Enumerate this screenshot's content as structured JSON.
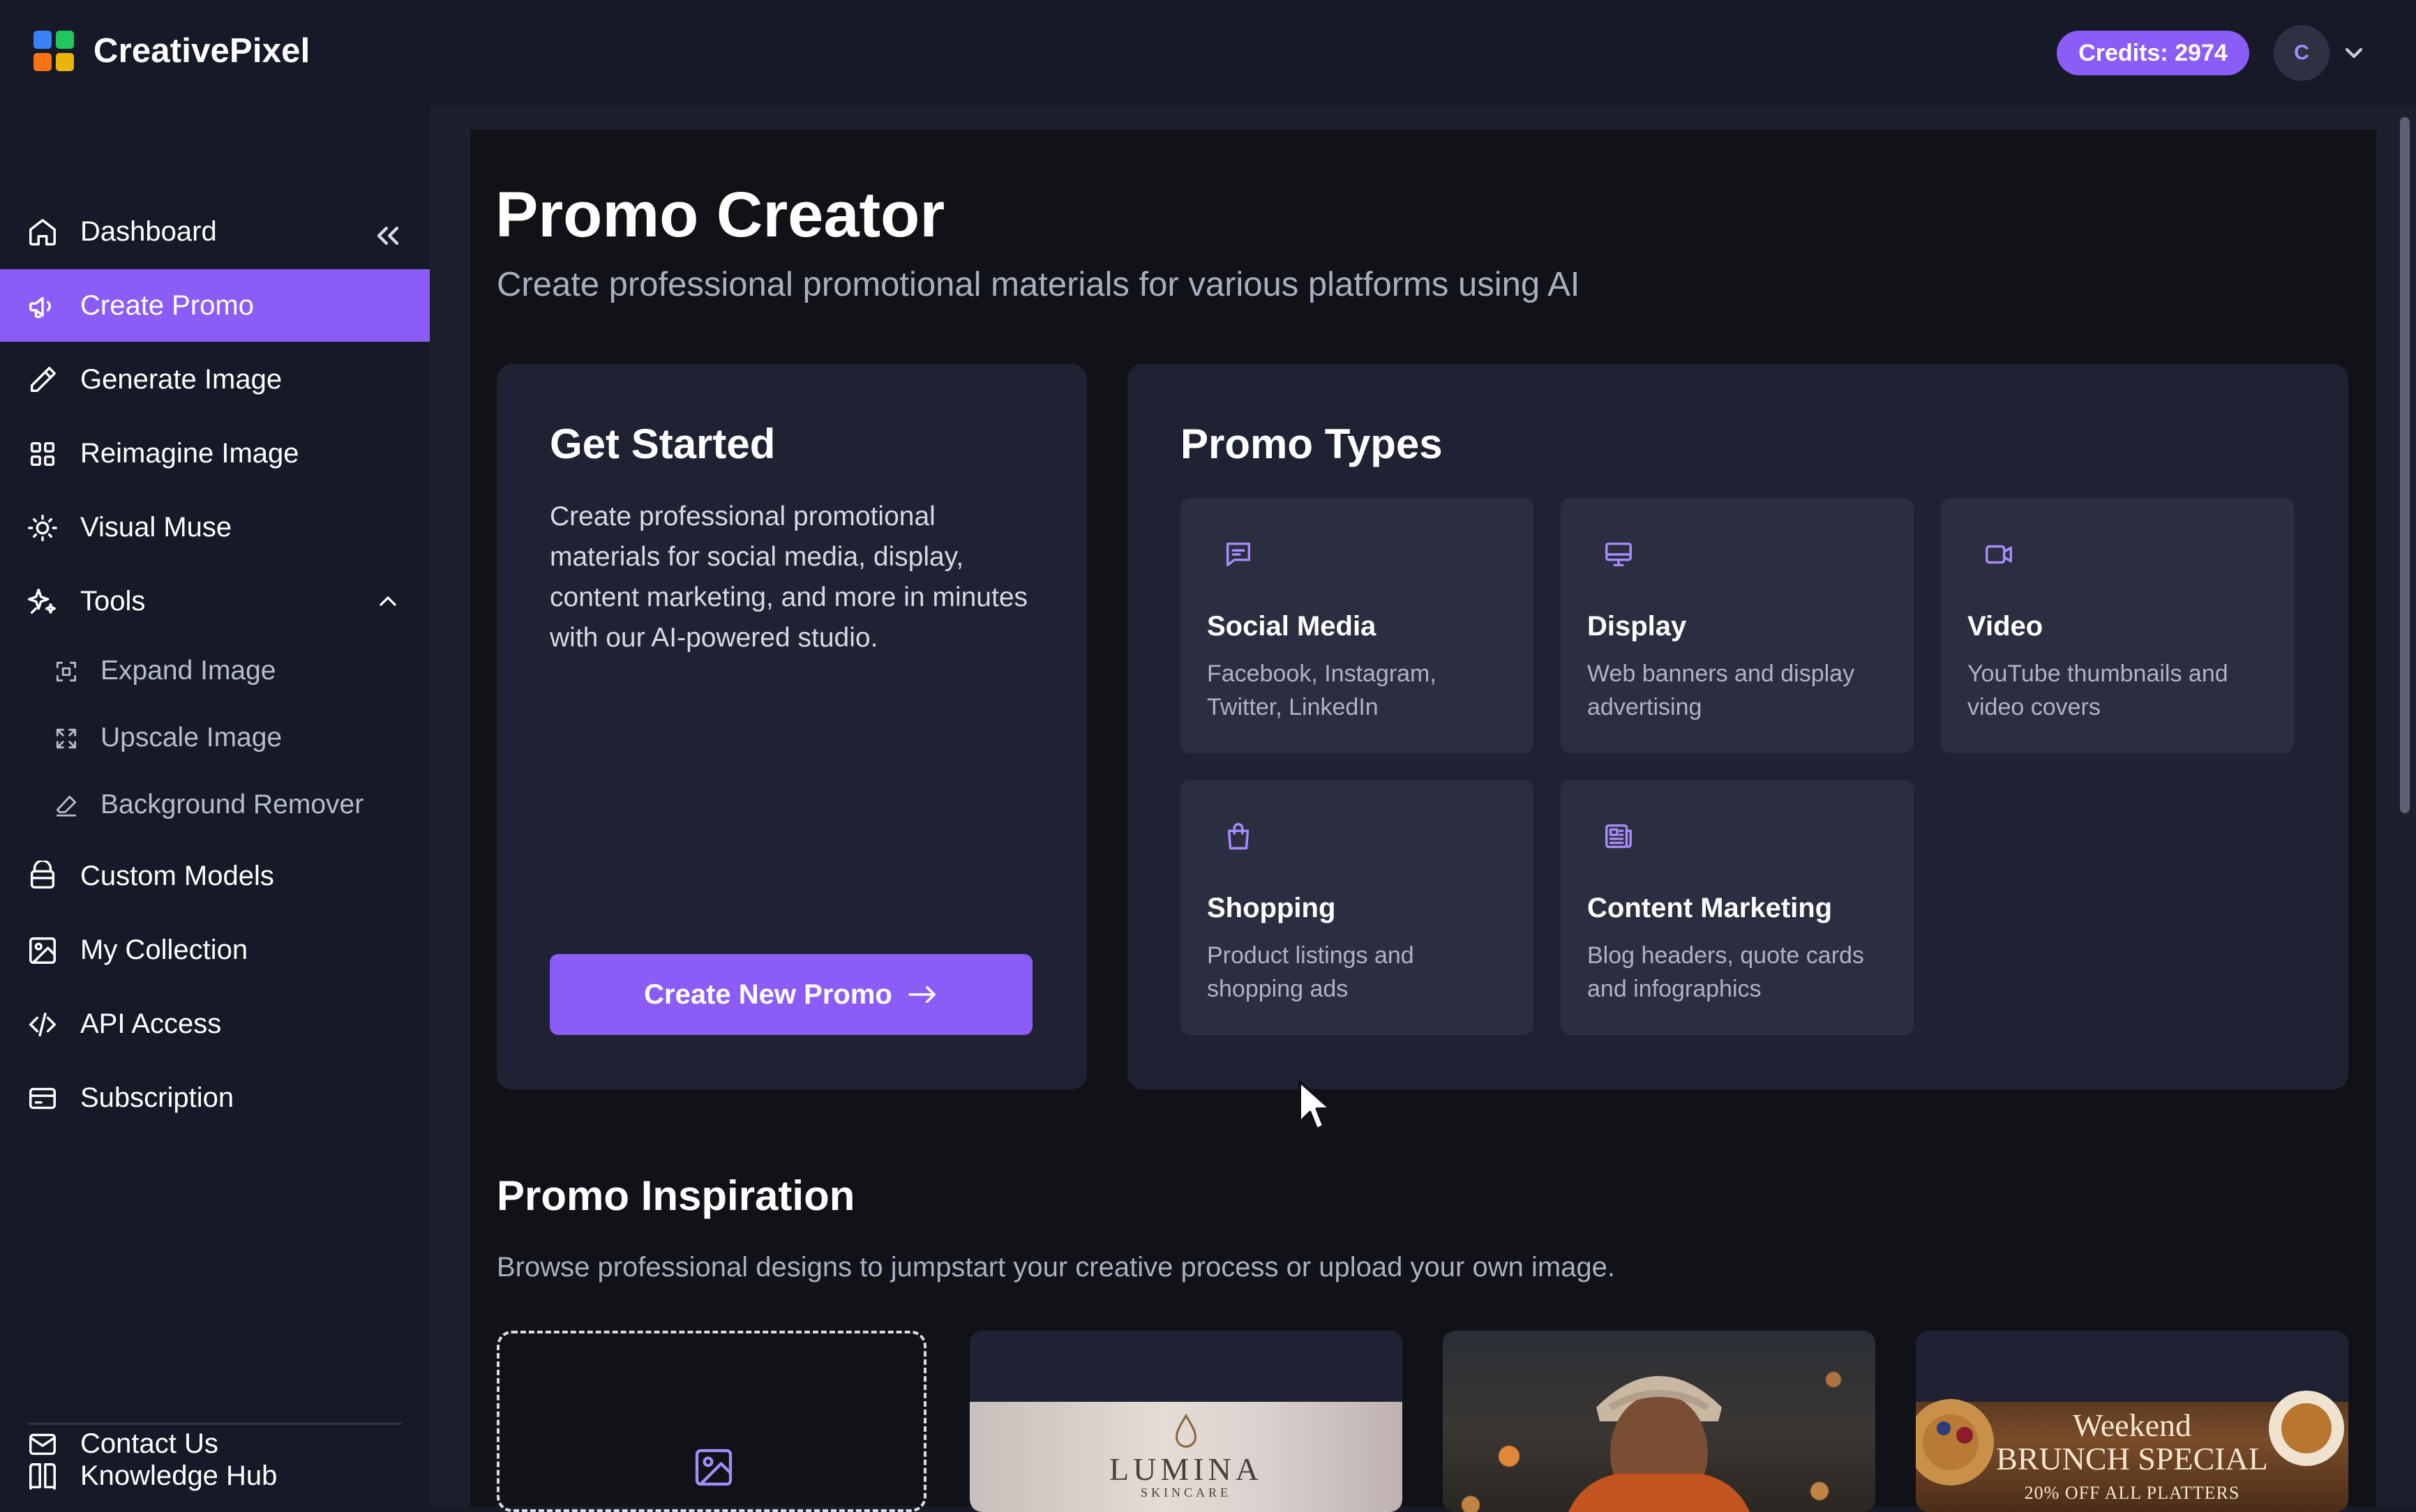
{
  "app": {
    "name": "CreativePixel",
    "credits": "Credits: 2974",
    "avatar_initial": "C"
  },
  "sidebar": {
    "items": [
      {
        "label": "Dashboard",
        "icon": "home-icon"
      },
      {
        "label": "Create Promo",
        "icon": "megaphone-icon",
        "active": true
      },
      {
        "label": "Generate Image",
        "icon": "pencil-icon"
      },
      {
        "label": "Reimagine Image",
        "icon": "grid-icon"
      },
      {
        "label": "Visual Muse",
        "icon": "lightbulb-icon"
      },
      {
        "label": "Tools",
        "icon": "sparkles-icon",
        "expanded": true
      }
    ],
    "tools": [
      {
        "label": "Expand Image",
        "icon": "expand-icon"
      },
      {
        "label": "Upscale Image",
        "icon": "upscale-icon"
      },
      {
        "label": "Background Remover",
        "icon": "eraser-icon"
      }
    ],
    "items2": [
      {
        "label": "Custom Models",
        "icon": "database-icon"
      },
      {
        "label": "My Collection",
        "icon": "image-icon"
      },
      {
        "label": "API Access",
        "icon": "code-icon"
      },
      {
        "label": "Subscription",
        "icon": "card-icon"
      }
    ],
    "footer": [
      {
        "label": "Knowledge Hub",
        "icon": "book-icon"
      },
      {
        "label": "Contact Us",
        "icon": "mail-icon"
      }
    ]
  },
  "main": {
    "title": "Promo Creator",
    "subtitle": "Create professional promotional materials for various platforms using AI",
    "get_started": {
      "title": "Get Started",
      "body": "Create professional promotional materials for social media, display, content marketing, and more in minutes with our AI-powered studio.",
      "cta": "Create New Promo"
    },
    "promo_types": {
      "title": "Promo Types",
      "types": [
        {
          "title": "Social Media",
          "desc": "Facebook, Instagram, Twitter, LinkedIn",
          "icon": "chat-icon"
        },
        {
          "title": "Display",
          "desc": "Web banners and display advertising",
          "icon": "monitor-icon"
        },
        {
          "title": "Video",
          "desc": "YouTube thumbnails and video covers",
          "icon": "video-icon"
        },
        {
          "title": "Shopping",
          "desc": "Product listings and shopping ads",
          "icon": "shopping-bag-icon"
        },
        {
          "title": "Content Marketing",
          "desc": "Blog headers, quote cards and infographics",
          "icon": "newspaper-icon"
        }
      ]
    },
    "inspiration": {
      "title": "Promo Inspiration",
      "subtitle": "Browse professional designs to jumpstart your creative process or upload your own image.",
      "lumina": {
        "name": "LUMINA",
        "tagline": "SKINCARE"
      },
      "brunch": {
        "line1": "Weekend",
        "line2": "BRUNCH SPECIAL",
        "line3": "20% OFF ALL PLATTERS"
      }
    }
  },
  "colors": {
    "accent": "#8b5cf6",
    "sidebar_bg": "#161a28",
    "panel_bg": "#111218",
    "card_bg": "#1f2233",
    "tile_bg": "#2b2e40",
    "icon_purple": "#a78bfa"
  }
}
